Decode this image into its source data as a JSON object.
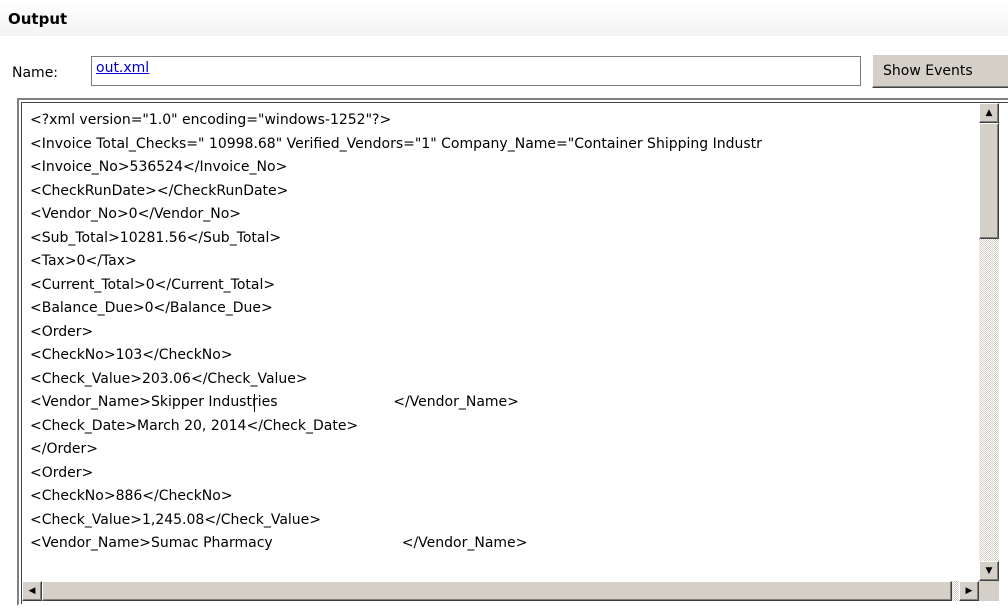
{
  "section": {
    "title": "Output"
  },
  "name_field": {
    "label": "Name:",
    "value": "out.xml"
  },
  "toolbar": {
    "show_events_label": "Show Events"
  },
  "editor": {
    "lines": [
      "<?xml version=\"1.0\" encoding=\"windows-1252\"?>",
      "<Invoice Total_Checks=\" 10998.68\" Verified_Vendors=\"1\" Company_Name=\"Container Shipping Industr",
      "<Invoice_No>536524</Invoice_No>",
      "<CheckRunDate></CheckRunDate>",
      "<Vendor_No>0</Vendor_No>",
      "<Sub_Total>10281.56</Sub_Total>",
      "<Tax>0</Tax>",
      "<Current_Total>0</Current_Total>",
      "<Balance_Due>0</Balance_Due>",
      "<Order>",
      "<CheckNo>103</CheckNo>",
      "<Check_Value>203.06</Check_Value>",
      "<Vendor_Name>Skipper Industries                          </Vendor_Name>",
      "<Check_Date>March 20, 2014</Check_Date>",
      "</Order>",
      "<Order>",
      "<CheckNo>886</CheckNo>",
      "<Check_Value>1,245.08</Check_Value>",
      "<Vendor_Name>Sumac Pharmacy                             </Vendor_Name>"
    ]
  },
  "scrollbars": {
    "up_glyph": "▲",
    "down_glyph": "▼",
    "left_glyph": "◀",
    "right_glyph": "▶"
  }
}
